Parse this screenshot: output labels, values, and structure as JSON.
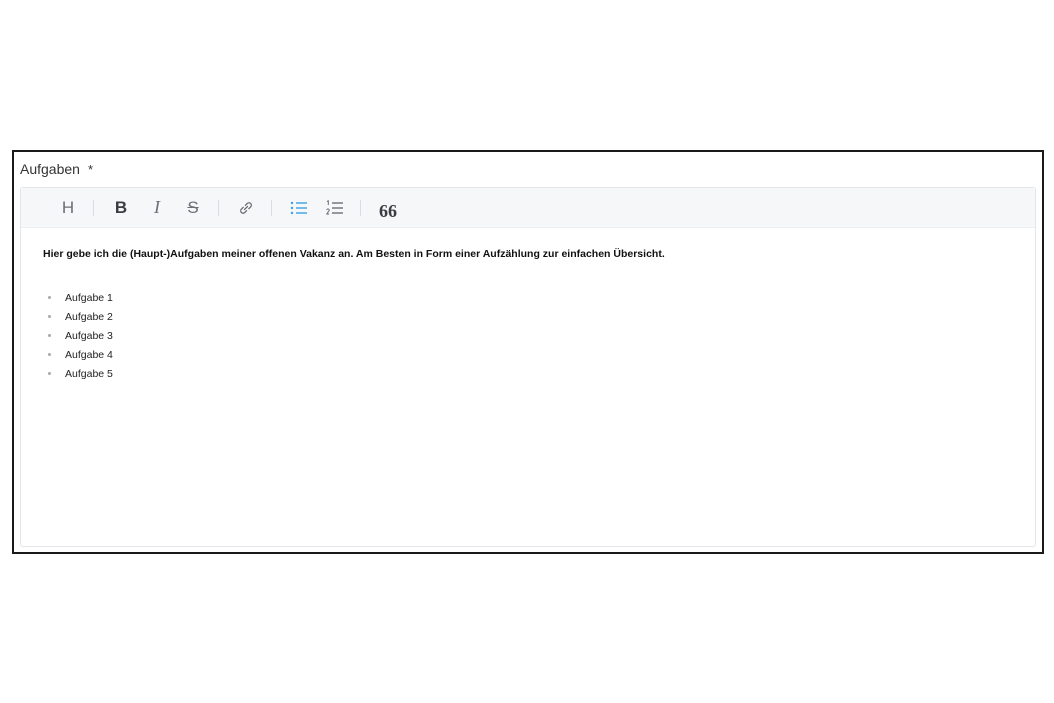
{
  "field": {
    "label": "Aufgaben",
    "required_marker": "*"
  },
  "toolbar": {
    "heading_label": "H",
    "bold_label": "B",
    "italic_label": "I",
    "strike_label": "S",
    "quote_label": "66",
    "accent_color": "#3b9fe8",
    "buttons": [
      {
        "name": "heading",
        "icon": "heading-icon"
      },
      {
        "name": "bold",
        "icon": "bold-icon"
      },
      {
        "name": "italic",
        "icon": "italic-icon"
      },
      {
        "name": "strikethrough",
        "icon": "strikethrough-icon"
      },
      {
        "name": "link",
        "icon": "link-icon"
      },
      {
        "name": "bulleted-list",
        "icon": "bulleted-list-icon",
        "active": true
      },
      {
        "name": "numbered-list",
        "icon": "numbered-list-icon"
      },
      {
        "name": "blockquote",
        "icon": "quote-icon"
      }
    ]
  },
  "content": {
    "intro": "Hier gebe ich die (Haupt-)Aufgaben meiner offenen Vakanz an. Am Besten in Form einer Aufzählung zur einfachen Übersicht.",
    "items": [
      "Aufgabe 1",
      "Aufgabe 2",
      "Aufgabe 3",
      "Aufgabe 4",
      "Aufgabe 5"
    ]
  }
}
